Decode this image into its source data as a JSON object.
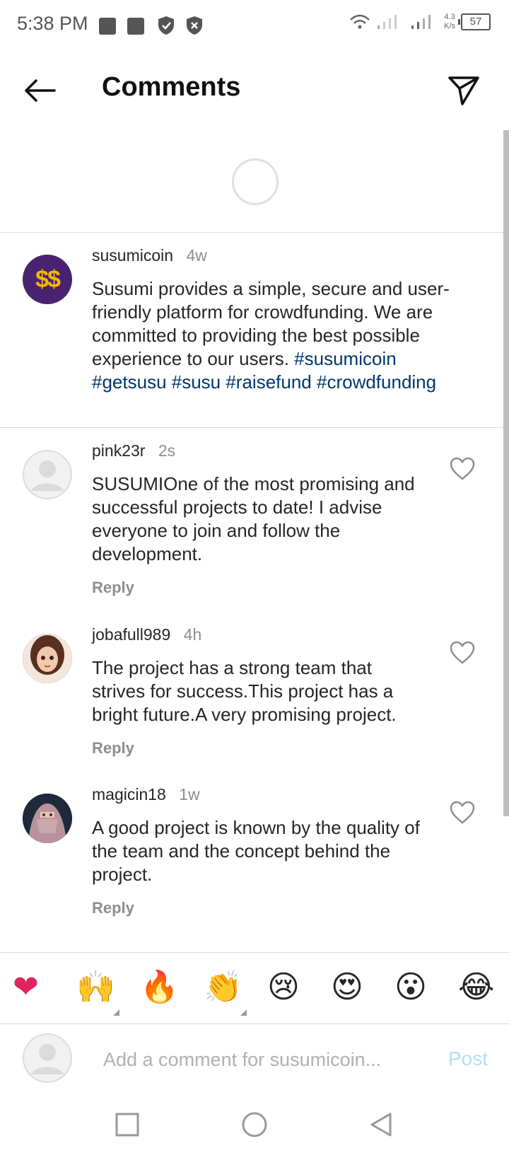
{
  "status_bar": {
    "time": "5:38 PM",
    "speed_value": "4.3",
    "speed_unit": "K/s",
    "battery": "57"
  },
  "header": {
    "title": "Comments"
  },
  "caption": {
    "username": "susumicoin",
    "time": "4w",
    "text": "Susumi provides a simple, secure and user-friendly platform for crowdfunding. We are committed to providing the best possible experience to our users.",
    "hashtags": "#susumicoin #getsusu #susu #raisefund #crowdfunding",
    "avatar_text": "$$"
  },
  "comments": [
    {
      "username": "pink23r",
      "time": "2s",
      "text": "SUSUMIOne of the most promising and successful projects to date! I advise everyone to join and follow the development.",
      "reply": "Reply"
    },
    {
      "username": "jobafull989",
      "time": "4h",
      "text": "The project has a strong team that strives for success.This project has a bright future.A very promising project.",
      "reply": "Reply"
    },
    {
      "username": "magicin18",
      "time": "1w",
      "text": "A good project is known by the quality of the team and the concept behind the project.",
      "reply": "Reply"
    }
  ],
  "emoji_bar": [
    "❤",
    "🙌",
    "🔥",
    "👏",
    "😢",
    "😍",
    "😮",
    "😂"
  ],
  "input": {
    "placeholder": "Add a comment for susumicoin...",
    "post_label": "Post"
  },
  "icons": {
    "back": "arrow-left-icon",
    "share": "paper-plane-icon",
    "heart": "heart-outline-icon",
    "nav": [
      "square-icon",
      "circle-icon",
      "triangle-back-icon"
    ]
  },
  "colors": {
    "hashtag": "#00376b",
    "post_disabled": "#b2dffc",
    "caption_avatar_bg": "#4a2370",
    "caption_avatar_fg": "#f5b800"
  }
}
